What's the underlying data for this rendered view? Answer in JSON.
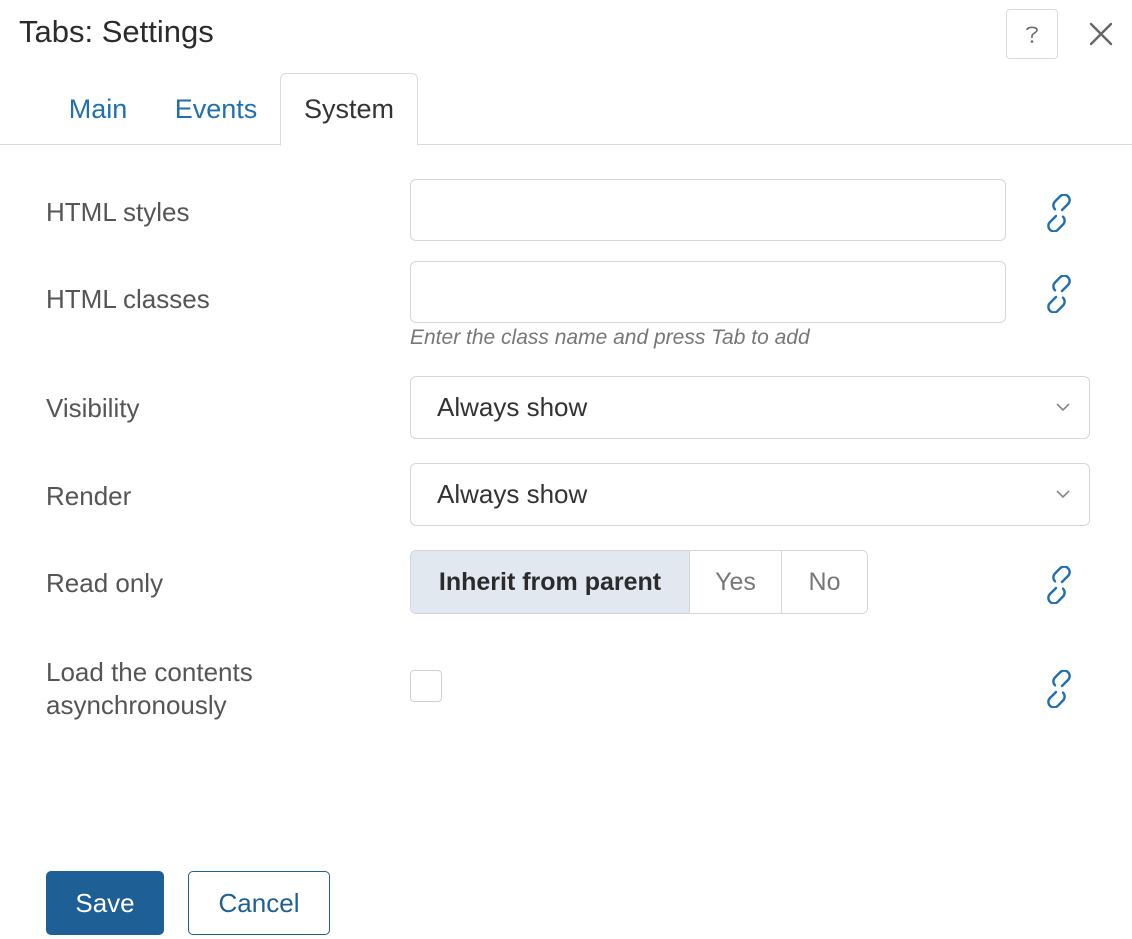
{
  "dialog": {
    "title": "Tabs: Settings",
    "help_icon": "help-question-icon",
    "close_icon": "close-icon"
  },
  "tabs": [
    {
      "label": "Main",
      "active": false
    },
    {
      "label": "Events",
      "active": false
    },
    {
      "label": "System",
      "active": true
    }
  ],
  "form": {
    "html_styles": {
      "label": "HTML styles",
      "value": ""
    },
    "html_classes": {
      "label": "HTML classes",
      "value": "",
      "hint": "Enter the class name and press Tab to add"
    },
    "visibility": {
      "label": "Visibility",
      "selected": "Always show"
    },
    "render": {
      "label": "Render",
      "selected": "Always show"
    },
    "read_only": {
      "label": "Read only",
      "options": [
        "Inherit from parent",
        "Yes",
        "No"
      ],
      "selected": "Inherit from parent"
    },
    "load_async": {
      "label_line1": "Load the contents",
      "label_line2": "asynchronously",
      "checked": false
    }
  },
  "footer": {
    "save_label": "Save",
    "cancel_label": "Cancel"
  },
  "colors": {
    "accent": "#1e5f95",
    "link": "#1f6fb2",
    "segment_active_bg": "#e1e8ef",
    "border": "#d3d7db"
  }
}
